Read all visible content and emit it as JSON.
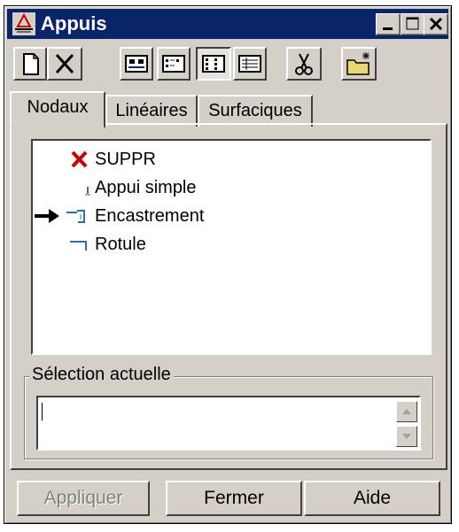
{
  "window": {
    "title": "Appuis",
    "title_bar_color": "#0a246a",
    "face_color": "#d4d0c8"
  },
  "title_buttons": [
    "minimize-icon",
    "maximize-icon",
    "close-icon"
  ],
  "toolbar": {
    "buttons": [
      {
        "icon": "new-document-icon",
        "pressed": false
      },
      {
        "icon": "delete-x-icon",
        "pressed": false
      },
      {
        "icon": "view-large-icons-icon",
        "pressed": false
      },
      {
        "icon": "view-small-icons-icon",
        "pressed": false
      },
      {
        "icon": "view-list-icon",
        "pressed": true
      },
      {
        "icon": "view-details-icon",
        "pressed": false
      },
      {
        "icon": "cut-scissors-icon",
        "pressed": false
      },
      {
        "icon": "new-folder-icon",
        "pressed": false
      }
    ]
  },
  "tabs": [
    {
      "label": "Nodaux",
      "active": true
    },
    {
      "label": "Linéaires",
      "active": false
    },
    {
      "label": "Surfaciques",
      "active": false
    }
  ],
  "list": {
    "items": [
      {
        "label": "SUPPR",
        "icon": "red-x-icon",
        "current": false
      },
      {
        "label": "Appui simple",
        "icon": "simple-support-icon",
        "current": false
      },
      {
        "label": "Encastrement",
        "icon": "fixed-support-icon",
        "current": true
      },
      {
        "label": "Rotule",
        "icon": "hinge-icon",
        "current": false
      }
    ],
    "current_marker_icon": "arrow-right-icon"
  },
  "selection": {
    "label": "Sélection actuelle",
    "value": ""
  },
  "buttons": {
    "apply": "Appliquer",
    "close": "Fermer",
    "help": "Aide"
  }
}
